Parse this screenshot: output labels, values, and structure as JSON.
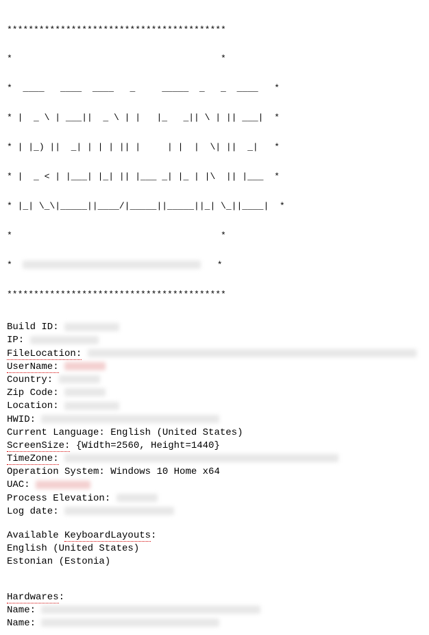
{
  "banner": {
    "stars_top": "*****************************************",
    "side_left": "*",
    "side_right": "*",
    "logo_lines": [
      "  ____   ____  ____   _     _____  _   _  ____ ",
      " |  _ \\ | ___||  _ \\ | |   |_   _|| \\ | || ___|",
      " | |_) ||  _| | | | || |     | |  |  \\| ||  _| ",
      " |  _ < | |___| |_| || |___ _| |_ | |\\  || |___",
      " |_| \\_\\|_____||____/|_____||_____||_| \\_||____|"
    ],
    "tag_label_redacted": true,
    "stars_bottom": "*****************************************"
  },
  "fields": {
    "build_id": {
      "label": "Build ID:",
      "value_redacted": true,
      "redunderline": false
    },
    "ip": {
      "label": "IP:",
      "value_redacted": true,
      "redunderline": false
    },
    "file_location": {
      "label": "FileLocation:",
      "value_redacted": true,
      "redunderline": true
    },
    "user_name": {
      "label": "UserName:",
      "value_redacted": true,
      "red_value": true,
      "redunderline": true
    },
    "country": {
      "label": "Country:",
      "value_redacted": true,
      "redunderline": false
    },
    "zip_code": {
      "label": "Zip Code:",
      "value_redacted": true,
      "redunderline": false
    },
    "location": {
      "label": "Location:",
      "value_redacted": true,
      "redunderline": false
    },
    "hwid": {
      "label": "HWID:",
      "value_redacted": true,
      "redunderline": false
    },
    "current_language": {
      "label": "Current Language:",
      "value": "English (United States)",
      "redunderline": false
    },
    "screen_size": {
      "label": "ScreenSize:",
      "value": "{Width=2560, Height=1440}",
      "redunderline": true
    },
    "time_zone": {
      "label": "TimeZone:",
      "value_redacted": true,
      "redunderline": true
    },
    "operation_system": {
      "label": "Operation System:",
      "value": "Windows 10 Home x64",
      "redunderline": false
    },
    "uac": {
      "label": "UAC:",
      "value_redacted": true,
      "red_value": true,
      "redunderline": false
    },
    "process_elevation": {
      "label": "Process Elevation:",
      "value_redacted": true,
      "redunderline": false
    },
    "log_date": {
      "label": "Log date:",
      "value_redacted": true,
      "redunderline": false
    }
  },
  "keyboard_layouts": {
    "heading_prefix": "Available ",
    "heading_word": "KeyboardLayouts",
    "heading_suffix": ":",
    "items": [
      "English (United States)",
      "Estonian (Estonia)"
    ]
  },
  "hardwares": {
    "heading": "Hardwares",
    "heading_suffix": ":",
    "rows": [
      {
        "label": "Name:",
        "value_redacted": true
      },
      {
        "label": "Name:",
        "value_redacted": true
      }
    ]
  }
}
